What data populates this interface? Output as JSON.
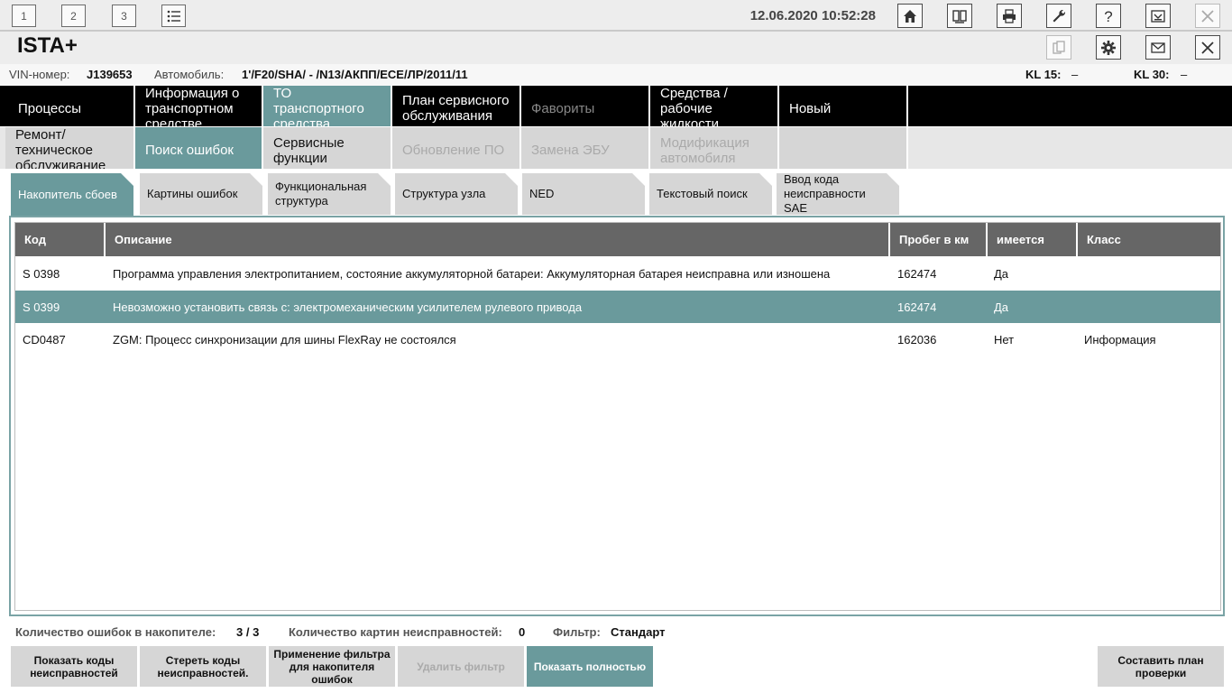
{
  "workspaces": [
    "1",
    "2",
    "3"
  ],
  "header": {
    "datetime": "12.06.2020 10:52:28",
    "app_title": "ISTA+"
  },
  "vehicle": {
    "vin_label": "VIN-номер:",
    "vin": "J139653",
    "car_label": "Автомобиль:",
    "car": "1'/F20/SHA/ - /N13/АКПП/ЕСЕ/ЛР/2011/11",
    "kl15_label": "KL 15:",
    "kl15": "–",
    "kl30_label": "KL 30:",
    "kl30": "–"
  },
  "nav_main": [
    "Процессы",
    "Информация о транспортном средстве",
    "ТО транспортного средства",
    "План сервисного обслуживания",
    "Фавориты",
    "Средства / рабочие жидкости",
    "Новый"
  ],
  "nav_sub": [
    "Ремонт/ техническое обслуживание",
    "Поиск ошибок",
    "Сервисные функции",
    "Обновление ПО",
    "Замена ЭБУ",
    "Модификация автомобиля"
  ],
  "tabs": [
    "Накопитель сбоев",
    "Картины ошибок",
    "Функциональная структура",
    "Структура узла",
    "NED",
    "Текстовый поиск",
    "Ввод кода неисправности SAE"
  ],
  "table": {
    "columns": [
      "Код",
      "Описание",
      "Пробег в км",
      "имеется",
      "Класс"
    ],
    "rows": [
      [
        "S 0398",
        "Программа управления электропитанием, состояние аккумуляторной батареи: Аккумуляторная батарея неисправна или изношена",
        "162474",
        "Да",
        ""
      ],
      [
        "S 0399",
        "Невозможно установить связь с: электромеханическим усилителем рулевого привода",
        "162474",
        "Да",
        ""
      ],
      [
        "CD0487",
        "ZGM: Процесс синхронизации для шины FlexRay не состоялся",
        "162036",
        "Нет",
        "Информация"
      ]
    ]
  },
  "status": {
    "errors_label": "Количество ошибок в накопителе:",
    "errors_value": "3 / 3",
    "pictures_label": "Количество картин неисправностей:",
    "pictures_value": "0",
    "filter_label": "Фильтр:",
    "filter_value": "Стандарт"
  },
  "buttons": {
    "show_codes": "Показать коды неисправностей",
    "erase_codes": "Стереть коды неисправностей.",
    "apply_filter": "Применение фильтра для накопителя ошибок",
    "delete_filter": "Удалить фильтр",
    "show_all": "Показать полностью",
    "make_plan": "Составить план проверки"
  },
  "colors": {
    "accent": "#6a9a9c",
    "nav_dark": "#000000",
    "header_gray": "#666666",
    "tab_gray": "#d6d6d6"
  }
}
